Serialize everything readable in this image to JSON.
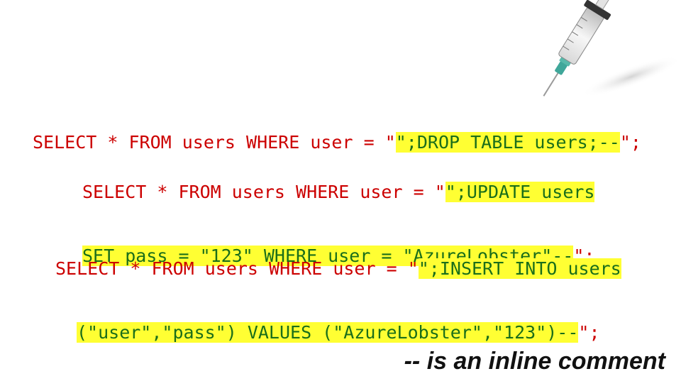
{
  "statements": [
    {
      "lines": [
        {
          "prefix": "SELECT * FROM users WHERE user = \"",
          "injected": "\";DROP TABLE users;--",
          "suffix": "\";"
        }
      ]
    },
    {
      "lines": [
        {
          "prefix": "SELECT * FROM users WHERE user = \"",
          "injected": "\";UPDATE users",
          "suffix": ""
        },
        {
          "prefix": "",
          "injected": "SET pass = \"123\" WHERE user = \"AzureLobster\"--",
          "suffix": "\";"
        }
      ]
    },
    {
      "lines": [
        {
          "prefix": "SELECT * FROM users WHERE user = \"",
          "injected": "\";INSERT INTO users",
          "suffix": ""
        },
        {
          "prefix": "",
          "injected": "(\"user\",\"pass\") VALUES (\"AzureLobster\",\"123\")--",
          "suffix": "\";"
        }
      ]
    }
  ],
  "caption": "-- is an inline comment",
  "colors": {
    "sql_text": "#cc0000",
    "injected_text": "#1a6e1a",
    "highlight": "#ffff33"
  },
  "icons": {
    "syringe": "syringe-icon"
  }
}
